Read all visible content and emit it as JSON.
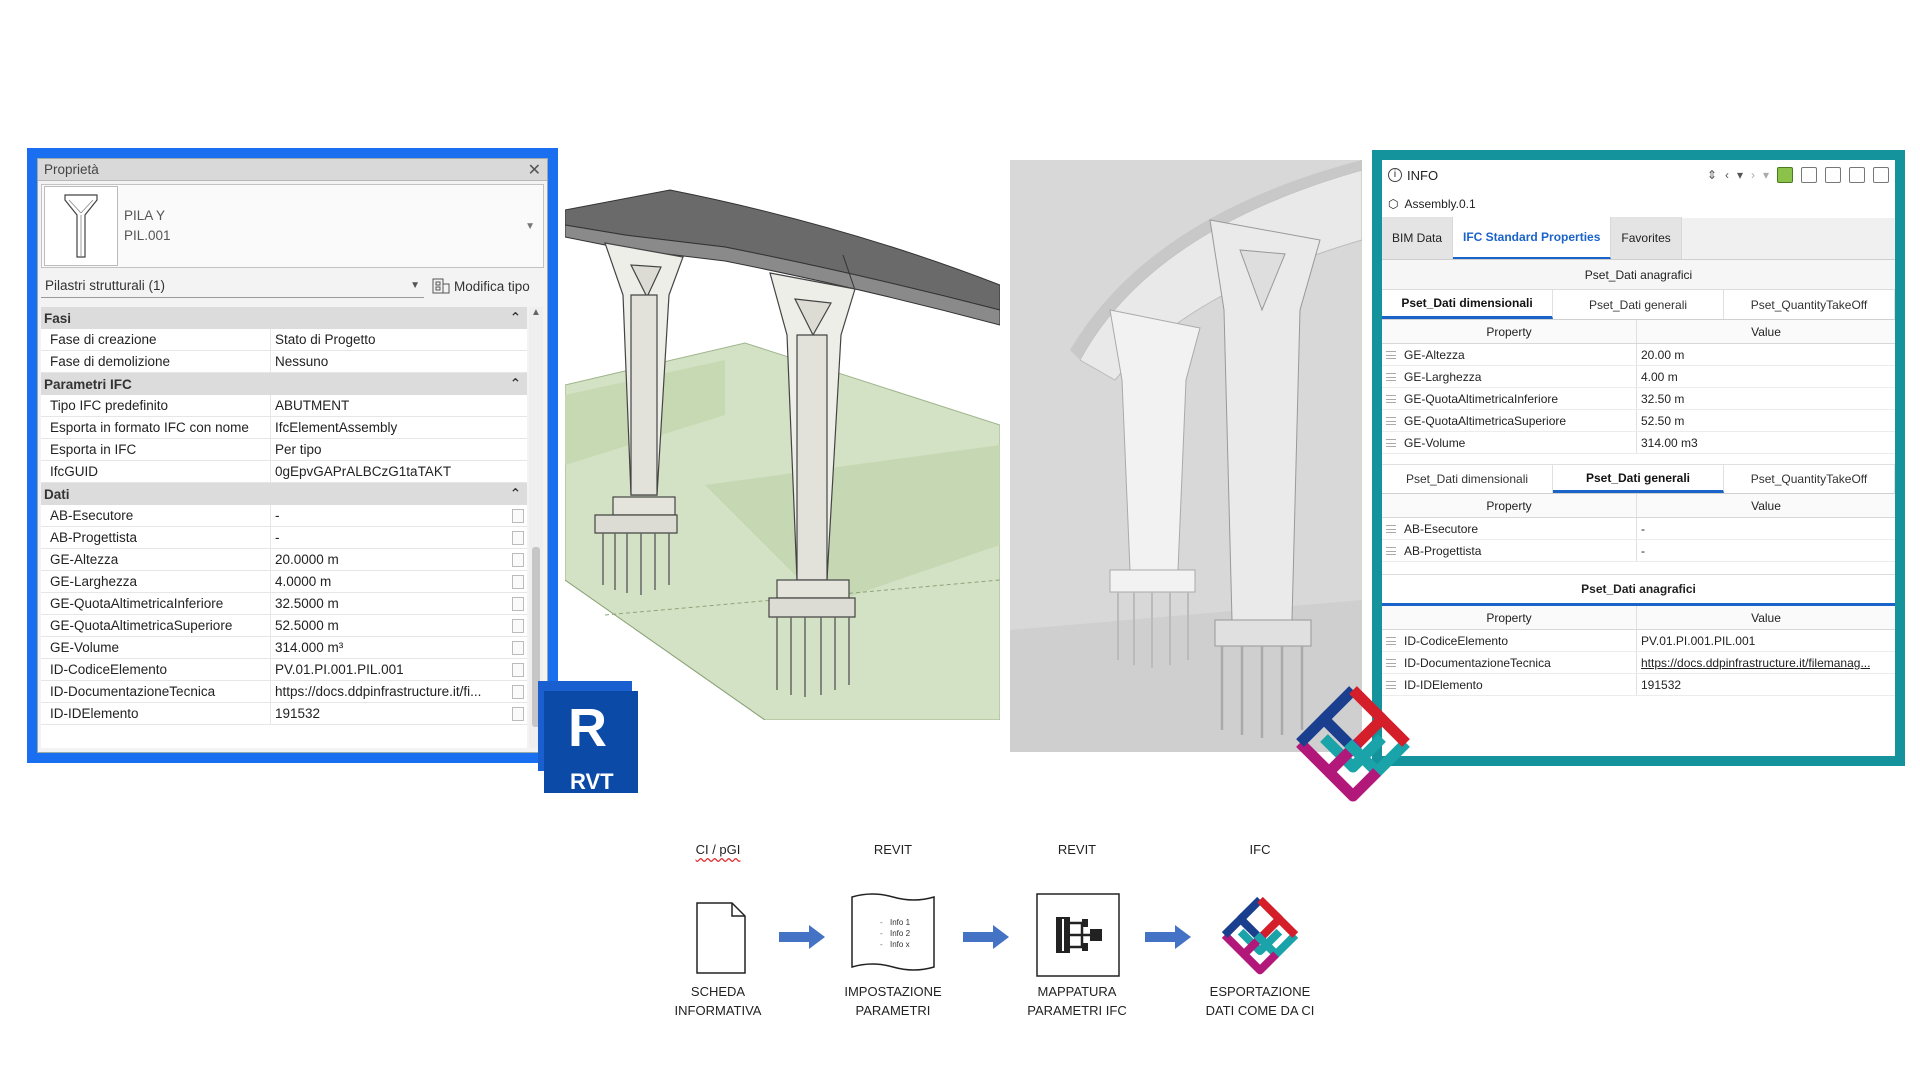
{
  "revit": {
    "title": "Proprietà",
    "type_name_line1": "PILA Y",
    "type_name_line2": "PIL.001",
    "filter": "Pilastri strutturali (1)",
    "edit_type": "Modifica tipo",
    "groups": [
      {
        "name": "Fasi",
        "rows": [
          {
            "k": "Fase di creazione",
            "v": "Stato di Progetto"
          },
          {
            "k": "Fase di demolizione",
            "v": "Nessuno"
          }
        ]
      },
      {
        "name": "Parametri IFC",
        "rows": [
          {
            "k": "Tipo IFC predefinito",
            "v": "ABUTMENT"
          },
          {
            "k": "Esporta in formato IFC con nome",
            "v": "IfcElementAssembly"
          },
          {
            "k": "Esporta in IFC",
            "v": "Per tipo"
          },
          {
            "k": "IfcGUID",
            "v": "0gEpvGAPrALBCzG1taTAKT"
          }
        ]
      },
      {
        "name": "Dati",
        "rows": [
          {
            "k": "AB-Esecutore",
            "v": "-"
          },
          {
            "k": "AB-Progettista",
            "v": "-"
          },
          {
            "k": "GE-Altezza",
            "v": "20.0000 m"
          },
          {
            "k": "GE-Larghezza",
            "v": "4.0000 m"
          },
          {
            "k": "GE-QuotaAltimetricaInferiore",
            "v": "32.5000 m"
          },
          {
            "k": "GE-QuotaAltimetricaSuperiore",
            "v": "52.5000 m"
          },
          {
            "k": "GE-Volume",
            "v": "314.000 m³"
          },
          {
            "k": "ID-CodiceElemento",
            "v": "PV.01.PI.001.PIL.001"
          },
          {
            "k": "ID-DocumentazioneTecnica",
            "v": "https://docs.ddpinfrastructure.it/fi..."
          },
          {
            "k": "ID-IDElemento",
            "v": "191532"
          }
        ]
      }
    ],
    "logo_letter": "R",
    "logo_text": "RVT",
    "accent": "#1a6ef0"
  },
  "ifc": {
    "header_title": "INFO",
    "assembly": "Assembly.0.1",
    "main_tabs": [
      "BIM Data",
      "IFC Standard Properties",
      "Favorites"
    ],
    "active_main_tab": 1,
    "section1_title": "Pset_Dati anagrafici",
    "subtabs": [
      "Pset_Dati dimensionali",
      "Pset_Dati generali",
      "Pset_QuantityTakeOff"
    ],
    "col_property": "Property",
    "col_value": "Value",
    "dimensionali": [
      {
        "k": "GE-Altezza",
        "v": "20.00 m"
      },
      {
        "k": "GE-Larghezza",
        "v": "4.00 m"
      },
      {
        "k": "GE-QuotaAltimetricaInferiore",
        "v": "32.50 m"
      },
      {
        "k": "GE-QuotaAltimetricaSuperiore",
        "v": "52.50 m"
      },
      {
        "k": "GE-Volume",
        "v": "314.00 m3"
      }
    ],
    "generali": [
      {
        "k": "AB-Esecutore",
        "v": "-"
      },
      {
        "k": "AB-Progettista",
        "v": "-"
      }
    ],
    "section2_title": "Pset_Dati anagrafici",
    "anagrafici": [
      {
        "k": "ID-CodiceElemento",
        "v": "PV.01.PI.001.PIL.001"
      },
      {
        "k": "ID-DocumentazioneTecnica",
        "v": "https://docs.ddpinfrastructure.it/filemanag..."
      },
      {
        "k": "ID-IDElemento",
        "v": "191532"
      }
    ],
    "accent": "#15939c",
    "tab_accent": "#1a63c8"
  },
  "workflow": {
    "steps": [
      {
        "top": "CI / pGI",
        "line1": "SCHEDA",
        "line2": "INFORMATIVA"
      },
      {
        "top": "REVIT",
        "line1": "IMPOSTAZIONE",
        "line2": "PARAMETRI"
      },
      {
        "top": "REVIT",
        "line1": "MAPPATURA",
        "line2": "PARAMETRI IFC"
      },
      {
        "top": "IFC",
        "line1": "ESPORTAZIONE",
        "line2": "DATI COME DA CI"
      }
    ],
    "doc_lines": [
      "Info 1",
      "Info 2",
      "Info x"
    ],
    "arrow_color": "#4472c4"
  }
}
